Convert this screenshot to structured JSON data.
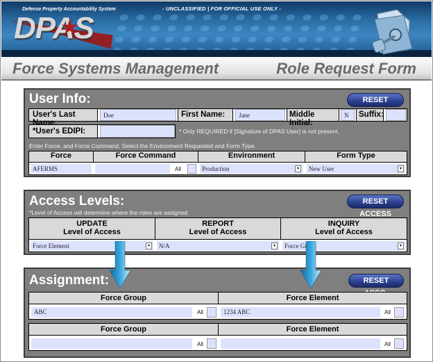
{
  "header": {
    "system_name": "Defense Property Accountability System",
    "classification": "- UNCLASSIFIED | FOR OFFICIAL USE ONLY -",
    "logo_text": "DPAS",
    "left_title": "Force Systems Management",
    "right_title": "Role Request Form"
  },
  "user_info": {
    "title": "User Info:",
    "reset_label": "RESET INFO",
    "last_name_label": "User's Last Name:",
    "last_name_value": "Doe",
    "first_name_label": "First Name:",
    "first_name_value": "Jane",
    "middle_initial_label": "Middle Initial:",
    "middle_initial_value": "N",
    "suffix_label": "Suffix:",
    "suffix_value": "",
    "edipi_label": "*User's EDIPI:",
    "edipi_value": "",
    "edipi_note": "* Only REQUIRED if [Signature of DPAS User] is not present.",
    "instructions": "Enter Force, and Force Command. Select the Environment Requested and Form Type.",
    "columns": [
      "Force",
      "Force Command",
      "Environment",
      "Form Type"
    ],
    "force_value": "AFERMS",
    "force_command_value": "",
    "force_command_all": "All",
    "environment_value": "Production",
    "form_type_value": "New User"
  },
  "access_levels": {
    "title": "Access Levels:",
    "reset_label": "RESET ACCESS",
    "note": "*Level of Access will determine where the roles are assigned",
    "columns": [
      {
        "line1": "UPDATE",
        "line2": "Level of Access",
        "value": "Force Element"
      },
      {
        "line1": "REPORT",
        "line2": "Level of Access",
        "value": "N/A"
      },
      {
        "line1": "INQUIRY",
        "line2": "Level of Access",
        "value": "Force Group"
      }
    ]
  },
  "assignment": {
    "title": "Assignment:",
    "reset_label": "RESET ASSG.",
    "rows": [
      {
        "left_header": "Force Group",
        "left_value": "ABC",
        "right_header": "Force Element",
        "right_value": "1234 ABC"
      },
      {
        "left_header": "Force Group",
        "left_value": "",
        "right_header": "Force Element",
        "right_value": ""
      }
    ],
    "all_label": "All"
  },
  "icons": {
    "dropdown": "▾",
    "star": "★"
  }
}
